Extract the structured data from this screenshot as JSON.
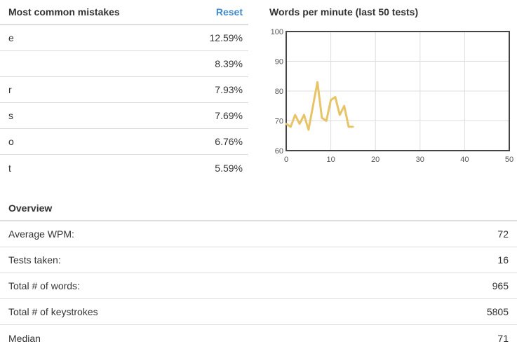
{
  "mistakes": {
    "title": "Most common mistakes",
    "reset_label": "Reset",
    "rows": [
      {
        "char": "e",
        "pct": "12.59%"
      },
      {
        "char": "",
        "pct": "8.39%"
      },
      {
        "char": "r",
        "pct": "7.93%"
      },
      {
        "char": "s",
        "pct": "7.69%"
      },
      {
        "char": "o",
        "pct": "6.76%"
      },
      {
        "char": "t",
        "pct": "5.59%"
      }
    ]
  },
  "wpm": {
    "title": "Words per minute (last 50 tests)"
  },
  "overview": {
    "title": "Overview",
    "rows": [
      {
        "label": "Average WPM:",
        "value": "72"
      },
      {
        "label": "Tests taken:",
        "value": "16"
      },
      {
        "label": "Total # of words:",
        "value": "965"
      },
      {
        "label": "Total # of keystrokes",
        "value": "5805"
      },
      {
        "label": "Median",
        "value": "71"
      }
    ]
  },
  "chart_data": {
    "type": "line",
    "title": "Words per minute (last 50 tests)",
    "x": [
      0,
      1,
      2,
      3,
      4,
      5,
      6,
      7,
      8,
      9,
      10,
      11,
      12,
      13,
      14,
      15
    ],
    "series": [
      {
        "values": [
          69,
          68,
          72,
          69,
          72,
          67,
          75,
          83,
          71,
          70,
          77,
          78,
          72,
          75,
          68,
          68
        ]
      }
    ],
    "xlim": [
      0,
      50
    ],
    "ylim": [
      60,
      100
    ],
    "xticks": [
      0,
      10,
      20,
      30,
      40,
      50
    ],
    "yticks": [
      60,
      70,
      80,
      90,
      100
    ],
    "grid": true,
    "line_color": "#e8c468"
  }
}
